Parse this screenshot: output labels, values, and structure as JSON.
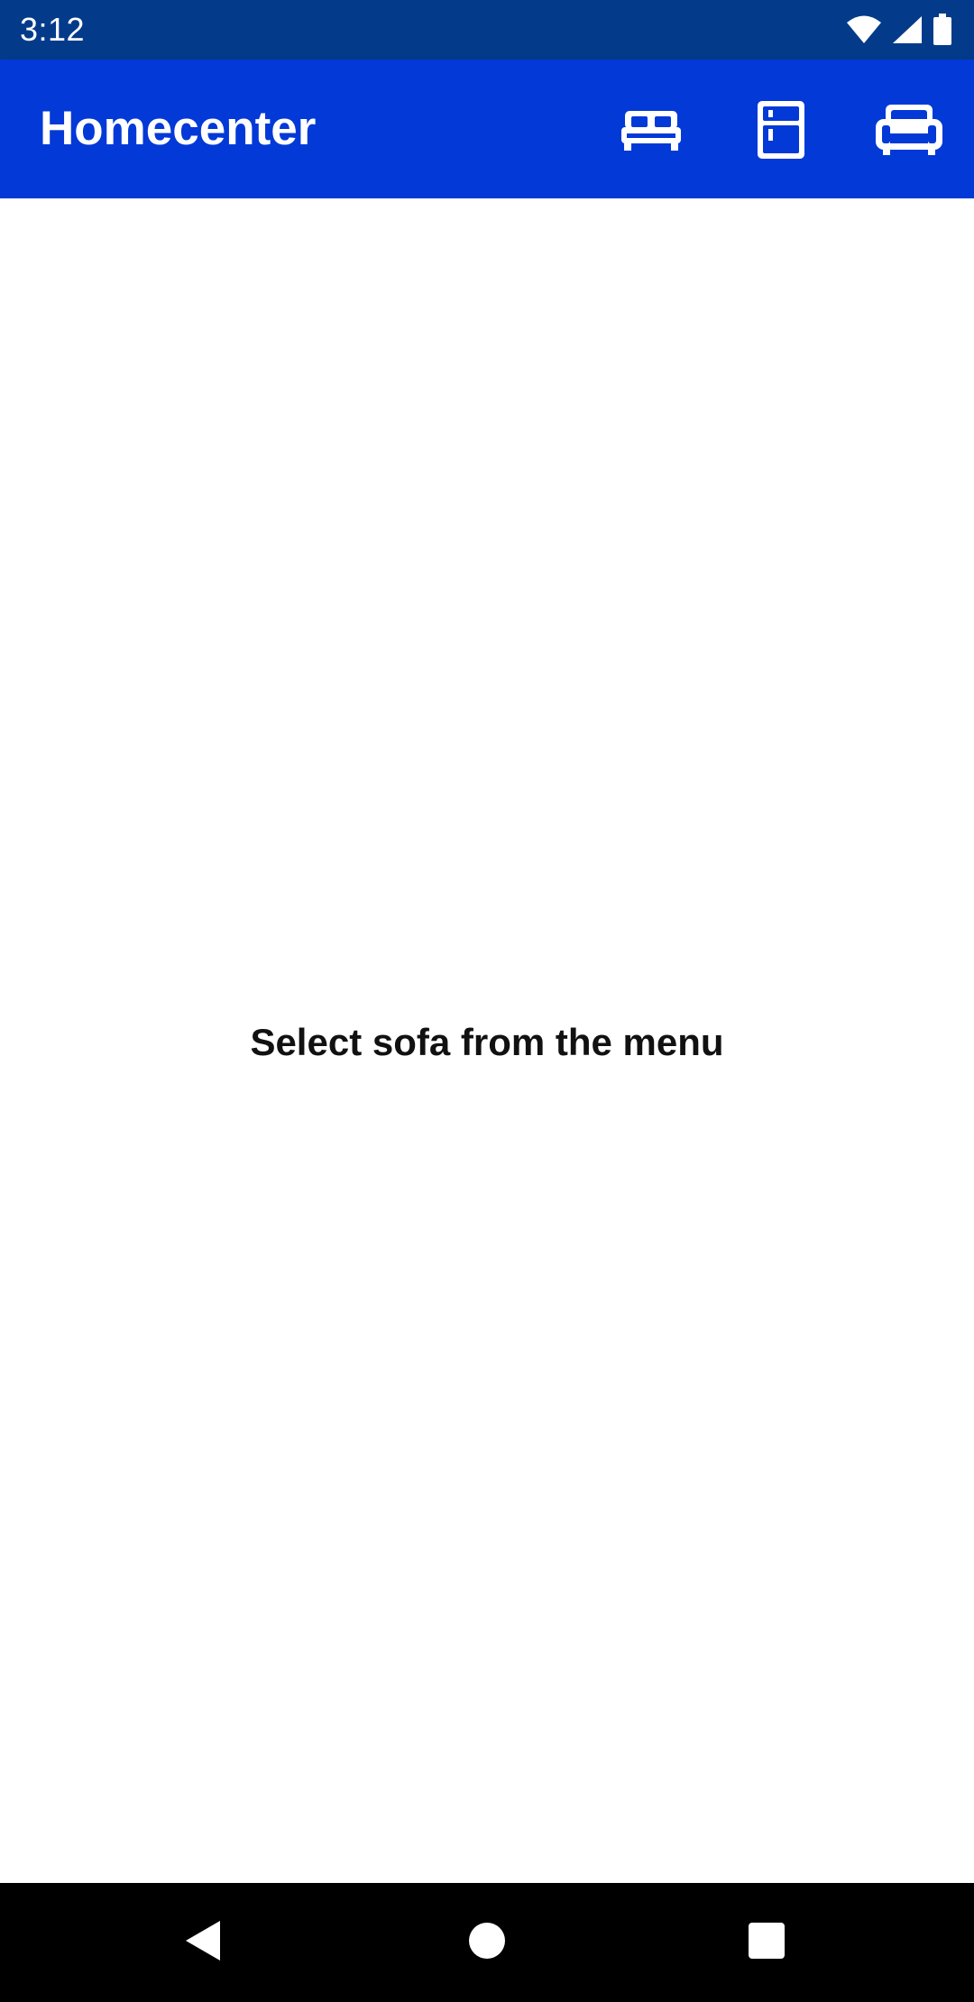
{
  "status_bar": {
    "time": "3:12",
    "icons": [
      "wifi-icon",
      "cellular-signal-icon",
      "battery-icon"
    ]
  },
  "app_bar": {
    "title": "Homecenter",
    "actions": [
      {
        "name": "bed",
        "icon": "bed-icon"
      },
      {
        "name": "fridge",
        "icon": "fridge-icon"
      },
      {
        "name": "sofa",
        "icon": "sofa-icon"
      }
    ]
  },
  "content": {
    "message": "Select sofa from the menu"
  },
  "nav_bar": {
    "buttons": [
      "back-icon",
      "home-icon",
      "recents-icon"
    ]
  },
  "colors": {
    "status_bar": "#033b8a",
    "app_bar": "#0339d7",
    "background": "#ffffff",
    "nav_bar": "#000000",
    "text": "#111111"
  }
}
